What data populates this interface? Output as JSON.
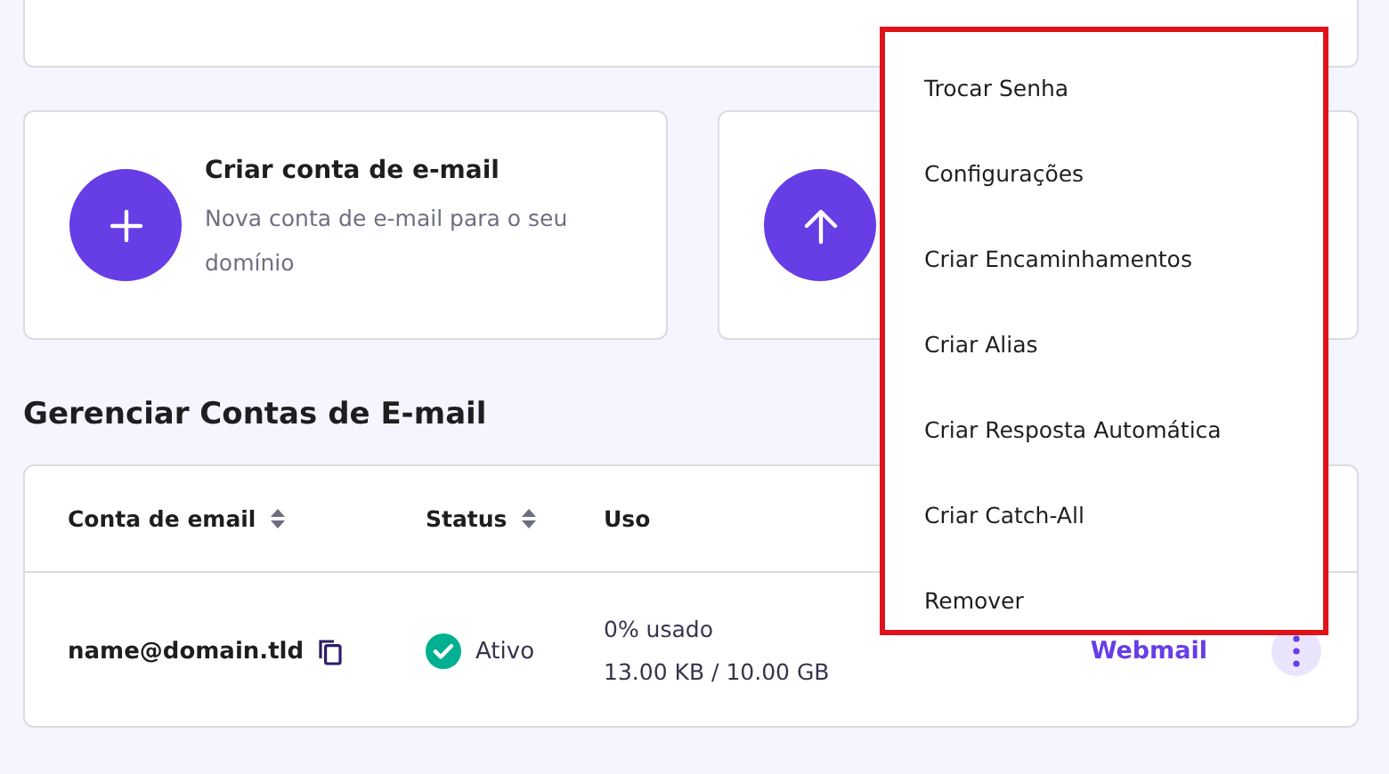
{
  "action_cards": [
    {
      "kind": "create",
      "title": "Criar conta de e-mail",
      "description": "Nova conta de e-mail para o seu domínio"
    },
    {
      "kind": "upload"
    }
  ],
  "section_title": "Gerenciar Contas de E-mail",
  "table": {
    "columns": [
      {
        "label": "Conta de email",
        "sortable": true
      },
      {
        "label": "Status",
        "sortable": true
      },
      {
        "label": "Uso",
        "sortable": false
      }
    ],
    "rows": [
      {
        "account": "name@domain.tld",
        "status": "Ativo",
        "active": true,
        "usage_percent": "0% usado",
        "usage_amount": "13.00 KB / 10.00 GB",
        "link": "Webmail"
      }
    ]
  },
  "context_menu": {
    "items": [
      "Trocar Senha",
      "Configurações",
      "Criar Encaminhamentos",
      "Criar Alias",
      "Criar Resposta Automática",
      "Criar Catch-All",
      "Remover"
    ]
  }
}
